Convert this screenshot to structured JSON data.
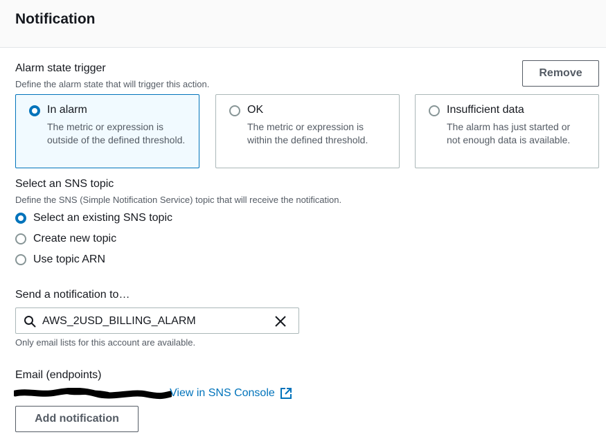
{
  "header": {
    "title": "Notification"
  },
  "alarm_state": {
    "label": "Alarm state trigger",
    "description": "Define the alarm state that will trigger this action.",
    "remove_label": "Remove",
    "options": [
      {
        "title": "In alarm",
        "description": "The metric or expression is outside of the defined threshold.",
        "selected": true
      },
      {
        "title": "OK",
        "description": "The metric or expression is within the defined threshold.",
        "selected": false
      },
      {
        "title": "Insufficient data",
        "description": "The alarm has just started or not enough data is available.",
        "selected": false
      }
    ]
  },
  "sns_topic": {
    "label": "Select an SNS topic",
    "description": "Define the SNS (Simple Notification Service) topic that will receive the notification.",
    "options": [
      {
        "label": "Select an existing SNS topic",
        "selected": true
      },
      {
        "label": "Create new topic",
        "selected": false
      },
      {
        "label": "Use topic ARN",
        "selected": false
      }
    ]
  },
  "send_to": {
    "label": "Send a notification to…",
    "value": "AWS_2USD_BILLING_ALARM",
    "hint": "Only email lists for this account are available."
  },
  "email": {
    "label": "Email (endpoints)",
    "link_label": "View in SNS Console"
  },
  "add_notification_label": "Add notification",
  "colors": {
    "accent": "#0073bb",
    "text": "#16191f",
    "muted": "#545b64",
    "border": "#aab7b8",
    "selected_bg": "#f1faff"
  },
  "icons": [
    "search-icon",
    "close-icon",
    "external-link-icon"
  ]
}
